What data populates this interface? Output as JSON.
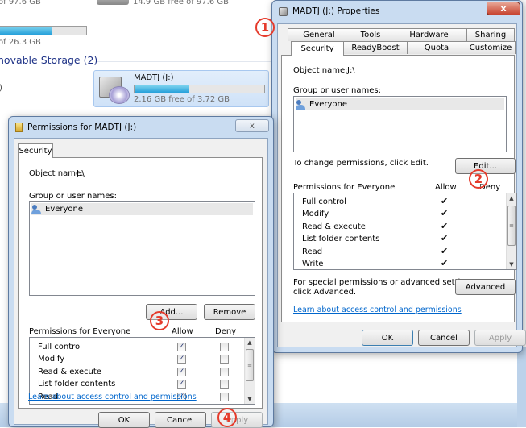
{
  "explorer": {
    "drive_top_free": "14.9 GB free of 97.6 GB",
    "left_top_text": "of 97.6 GB",
    "left_mid_text": "of 26.3 GB",
    "section_heading": "novable Storage (2)",
    "paren_fragment": ")",
    "drive_name": "MADTJ (J:)",
    "drive_free": "2.16 GB free of 3.72 GB",
    "drive_usage_fraction": 0.42,
    "left_bar_fraction": 0.6
  },
  "properties": {
    "title": "MADTJ (J:) Properties",
    "close_label": "x",
    "tabs_row1": [
      "General",
      "Tools",
      "Hardware",
      "Sharing"
    ],
    "tabs_row2": [
      "Security",
      "ReadyBoost",
      "Quota",
      "Customize"
    ],
    "object_name_label": "Object name:",
    "object_name_value": "J:\\",
    "group_label": "Group or user names:",
    "users": [
      "Everyone"
    ],
    "change_text": "To change permissions, click Edit.",
    "edit_button": "Edit...",
    "perm_header": "Permissions for Everyone",
    "allow_header": "Allow",
    "deny_header": "Deny",
    "permissions": [
      "Full control",
      "Modify",
      "Read & execute",
      "List folder contents",
      "Read",
      "Write"
    ],
    "special_text_1": "For special permissions or advanced settings,",
    "special_text_2": "click Advanced.",
    "advanced_button": "Advanced",
    "learn_link": "Learn about access control and permissions",
    "ok": "OK",
    "cancel": "Cancel",
    "apply": "Apply"
  },
  "permissions_dialog": {
    "title": "Permissions for MADTJ (J:)",
    "close_label": "x",
    "tab": "Security",
    "object_name_label": "Object name:",
    "object_name_value": "J:\\",
    "group_label": "Group or user names:",
    "users": [
      "Everyone"
    ],
    "add_button": "Add...",
    "remove_button": "Remove",
    "perm_header": "Permissions for Everyone",
    "allow_header": "Allow",
    "deny_header": "Deny",
    "permissions": [
      "Full control",
      "Modify",
      "Read & execute",
      "List folder contents",
      "Read"
    ],
    "allow_checked": [
      true,
      true,
      true,
      true,
      true
    ],
    "deny_checked": [
      false,
      false,
      false,
      false,
      false
    ],
    "learn_link": "Learn about access control and permissions",
    "ok": "OK",
    "cancel": "Cancel",
    "apply": "Apply"
  },
  "annotations": [
    "1",
    "2",
    "3",
    "4"
  ]
}
